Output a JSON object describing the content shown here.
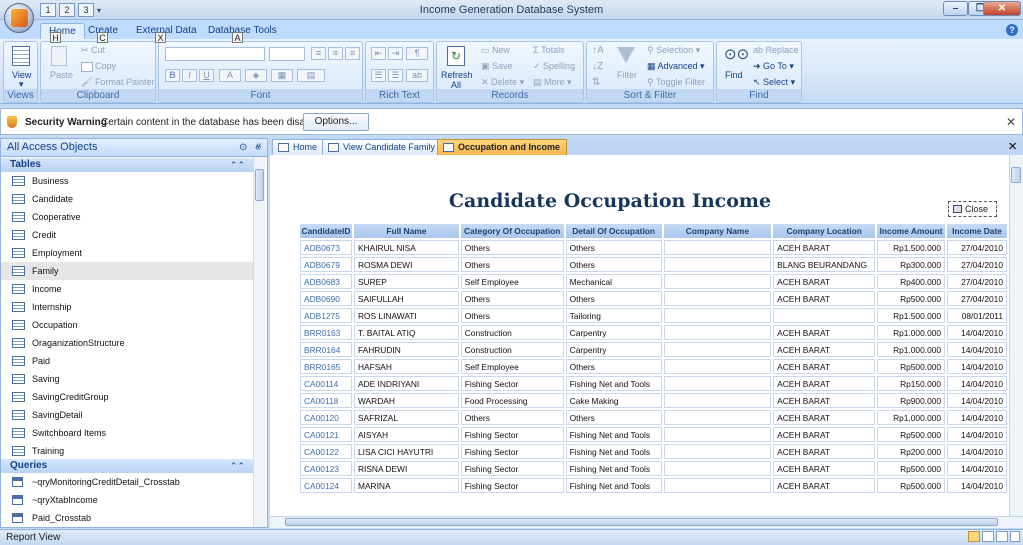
{
  "window": {
    "title": "Income Generation Database System"
  },
  "qat_keytips": [
    "1",
    "2",
    "3"
  ],
  "ribbon_tabs": [
    {
      "label": "Home",
      "keytip": "H"
    },
    {
      "label": "Create",
      "keytip": "C"
    },
    {
      "label": "External Data",
      "keytip": "X"
    },
    {
      "label": "Database Tools",
      "keytip": "A"
    }
  ],
  "ribbon": {
    "views": {
      "label": "Views",
      "view": "View"
    },
    "clipboard": {
      "label": "Clipboard",
      "paste": "Paste",
      "cut": "Cut",
      "copy": "Copy",
      "format_painter": "Format Painter"
    },
    "font": {
      "label": "Font",
      "bold": "B",
      "italic": "I",
      "underline": "U"
    },
    "rich_text": {
      "label": "Rich Text"
    },
    "records": {
      "label": "Records",
      "refresh": "Refresh All",
      "new": "New",
      "save": "Save",
      "delete": "Delete",
      "totals": "Totals",
      "spelling": "Spelling",
      "more": "More"
    },
    "sort_filter": {
      "label": "Sort & Filter",
      "filter": "Filter",
      "selection": "Selection",
      "advanced": "Advanced",
      "toggle_filter": "Toggle Filter"
    },
    "find": {
      "label": "Find",
      "find": "Find",
      "replace": "Replace",
      "goto": "Go To",
      "select": "Select"
    }
  },
  "security": {
    "title": "Security Warning",
    "message": "Certain content in the database has been disabled",
    "options": "Options..."
  },
  "nav": {
    "title": "All Access Objects",
    "tables_header": "Tables",
    "tables": [
      "Business",
      "Candidate",
      "Cooperative",
      "Credit",
      "Employment",
      "Family",
      "Income",
      "Internship",
      "Occupation",
      "OraganizationStructure",
      "Paid",
      "Saving",
      "SavingCreditGroup",
      "SavingDetail",
      "Switchboard Items",
      "Training"
    ],
    "selected": "Family",
    "queries_header": "Queries",
    "queries": [
      "~qryMonitoringCreditDetail_Crosstab",
      "~qryXtabIncome",
      "Paid_Crosstab"
    ]
  },
  "doc_tabs": [
    "Home",
    "View Candidate Family",
    "Occupation and Income"
  ],
  "report": {
    "title": "Candidate Occupation Income",
    "close": "Close",
    "columns": [
      "CandidateID",
      "Full Name",
      "Category Of Occupation",
      "Detail Of Occupation",
      "Company Name",
      "Company Location",
      "Income Amount",
      "Income Date"
    ],
    "rows": [
      [
        "ADB0673",
        "KHAIRUL NISA",
        "Others",
        "Others",
        "",
        "ACEH BARAT",
        "Rp1.500.000",
        "27/04/2010"
      ],
      [
        "ADB0679",
        "ROSMA DEWI",
        "Others",
        "Others",
        "",
        "BLANG BEURANDANG",
        "Rp300.000",
        "27/04/2010"
      ],
      [
        "ADB0683",
        "SUREP",
        "Self Employee",
        "Mechanical",
        "",
        "ACEH BARAT",
        "Rp400.000",
        "27/04/2010"
      ],
      [
        "ADB0690",
        "SAIFULLAH",
        "Others",
        "Others",
        "",
        "ACEH BARAT",
        "Rp500.000",
        "27/04/2010"
      ],
      [
        "ADB1275",
        "ROS LINAWATI",
        "Others",
        "Tailoring",
        "",
        "",
        "Rp1.500.000",
        "08/01/2011"
      ],
      [
        "BRR0163",
        "T. BAITAL ATIQ",
        "Construction",
        "Carpentry",
        "",
        "ACEH BARAT",
        "Rp1.000.000",
        "14/04/2010"
      ],
      [
        "BRR0164",
        "FAHRUDIN",
        "Construction",
        "Carpentry",
        "",
        "ACEH BARAT",
        "Rp1.000.000",
        "14/04/2010"
      ],
      [
        "BRR0165",
        "HAFSAH",
        "Self Employee",
        "Others",
        "",
        "ACEH BARAT",
        "Rp500.000",
        "14/04/2010"
      ],
      [
        "CA00114",
        "ADE INDRIYANI",
        "Fishing Sector",
        "Fishing Net and Tools",
        "",
        "ACEH BARAT",
        "Rp150.000",
        "14/04/2010"
      ],
      [
        "CA00118",
        "WARDAH",
        "Food Processing",
        "Cake Making",
        "",
        "ACEH BARAT",
        "Rp900.000",
        "14/04/2010"
      ],
      [
        "CA00120",
        "SAFRIZAL",
        "Others",
        "Others",
        "",
        "ACEH BARAT",
        "Rp1.000.000",
        "14/04/2010"
      ],
      [
        "CA00121",
        "AISYAH",
        "Fishing Sector",
        "Fishing Net and Tools",
        "",
        "ACEH BARAT",
        "Rp500.000",
        "14/04/2010"
      ],
      [
        "CA00122",
        "LISA CICI HAYUTRI",
        "Fishing Sector",
        "Fishing Net and Tools",
        "",
        "ACEH BARAT",
        "Rp200.000",
        "14/04/2010"
      ],
      [
        "CA00123",
        "RISNA DEWI",
        "Fishing Sector",
        "Fishing Net and Tools",
        "",
        "ACEH BARAT",
        "Rp500.000",
        "14/04/2010"
      ],
      [
        "CA00124",
        "MARINA",
        "Fishing Sector",
        "Fishing Net and Tools",
        "",
        "ACEH BARAT",
        "Rp500.000",
        "14/04/2010"
      ]
    ]
  },
  "status": {
    "text": "Report View"
  }
}
